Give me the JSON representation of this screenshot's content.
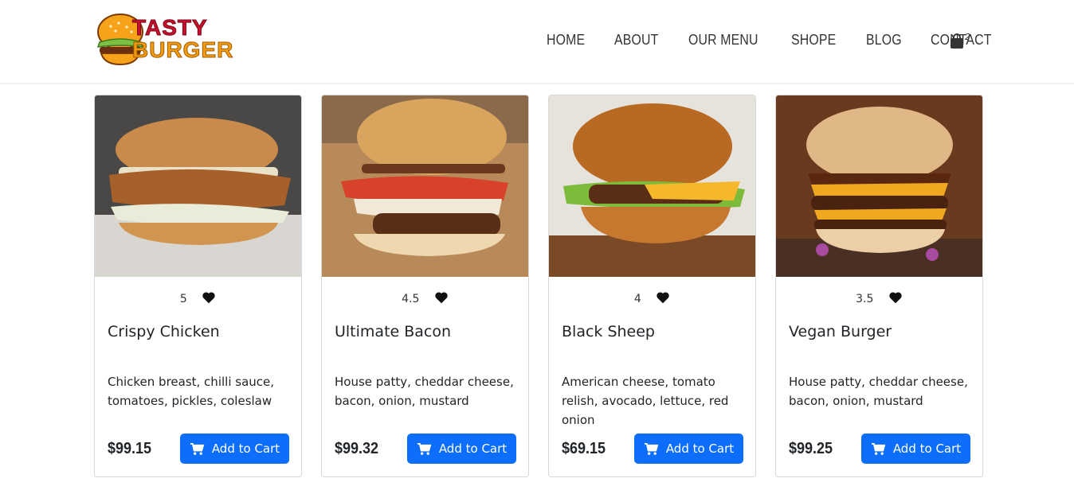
{
  "brand": {
    "line1": "TASTY",
    "line2": "BURGER"
  },
  "nav": {
    "items": [
      "HOME",
      "ABOUT",
      "OUR MENU",
      "SHOPE",
      "BLOG",
      "CONTACT"
    ],
    "cart_count": "2"
  },
  "colors": {
    "primary_button": "#0d6efd",
    "brand_red": "#c8102e",
    "brand_orange": "#f39c12"
  },
  "products": [
    {
      "rating": "5",
      "title": "Crispy Chicken",
      "description": "Chicken breast, chilli sauce, tomatoes, pickles, coleslaw",
      "price": "$99.15",
      "button": "Add to Cart"
    },
    {
      "rating": "4.5",
      "title": "Ultimate Bacon",
      "description": "House patty, cheddar cheese, bacon, onion, mustard",
      "price": "$99.32",
      "button": "Add to Cart"
    },
    {
      "rating": "4",
      "title": "Black Sheep",
      "description": "American cheese, tomato relish, avocado, lettuce, red onion",
      "price": "$69.15",
      "button": "Add to Cart"
    },
    {
      "rating": "3.5",
      "title": "Vegan Burger",
      "description": "House patty, cheddar cheese, bacon, onion, mustard",
      "price": "$99.25",
      "button": "Add to Cart"
    }
  ]
}
